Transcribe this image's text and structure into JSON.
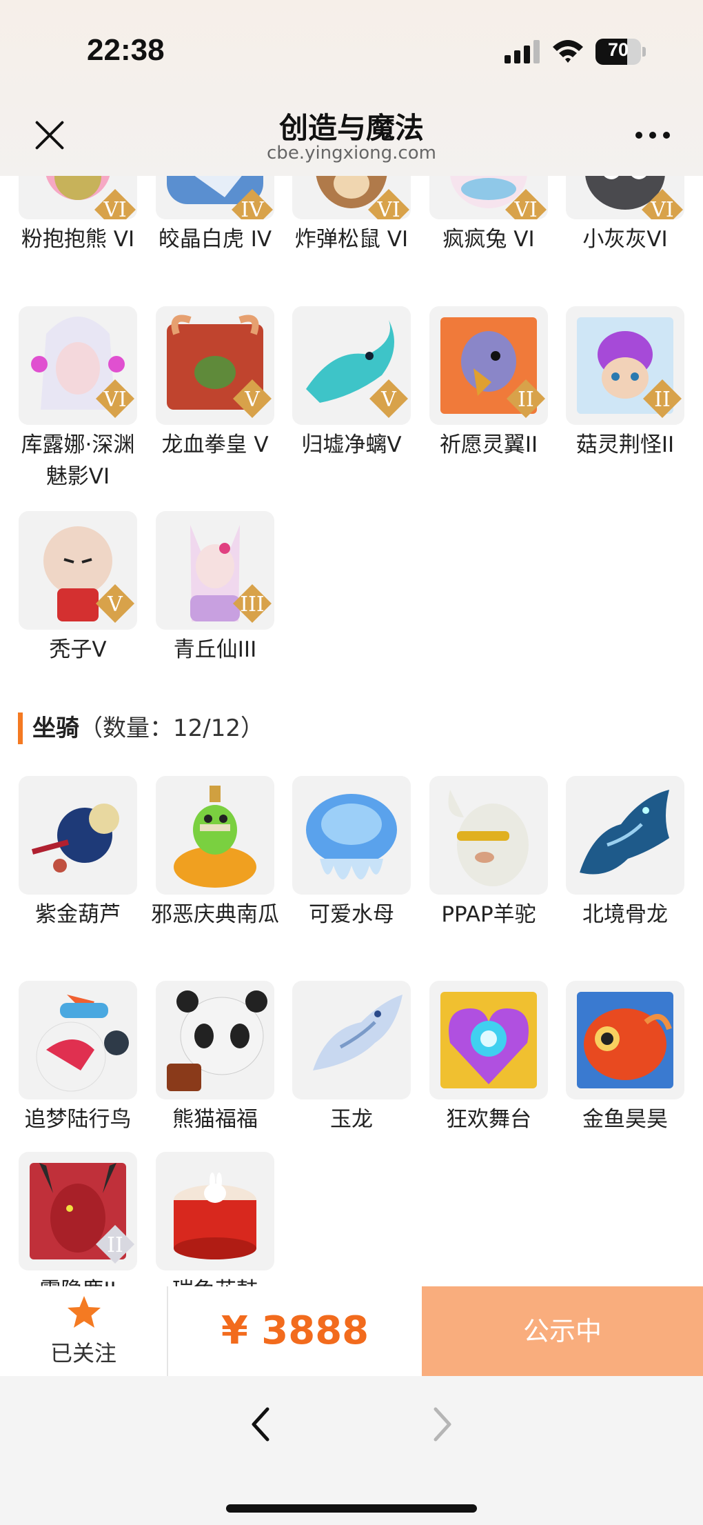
{
  "status_bar": {
    "time": "22:38",
    "battery": "70"
  },
  "header": {
    "title": "创造与魔法",
    "url": "cbe.yingxiong.com"
  },
  "pets": [
    {
      "name": "粉抱抱熊 VI",
      "tier": "VI"
    },
    {
      "name": "皎晶白虎 IV",
      "tier": "IV"
    },
    {
      "name": "炸弹松鼠 VI",
      "tier": "VI"
    },
    {
      "name": "疯疯兔 VI",
      "tier": "VI"
    },
    {
      "name": "小灰灰VI",
      "tier": "VI"
    },
    {
      "name": "库露娜·深渊魅影VI",
      "tier": "VI"
    },
    {
      "name": "龙血拳皇 V",
      "tier": "V"
    },
    {
      "name": "归墟净螭V",
      "tier": "V"
    },
    {
      "name": "祈愿灵翼II",
      "tier": "II"
    },
    {
      "name": "菇灵荆怪II",
      "tier": "II"
    },
    {
      "name": "秃子V",
      "tier": "V"
    },
    {
      "name": "青丘仙III",
      "tier": "III"
    }
  ],
  "mounts_section": {
    "title": "坐骑",
    "count": "（数量：12/12）"
  },
  "mounts": [
    {
      "name": "紫金葫芦",
      "tier": ""
    },
    {
      "name": "邪恶庆典南瓜",
      "tier": ""
    },
    {
      "name": "可爱水母",
      "tier": ""
    },
    {
      "name": "PPAP羊驼",
      "tier": ""
    },
    {
      "name": "北境骨龙",
      "tier": ""
    },
    {
      "name": "追梦陆行鸟",
      "tier": ""
    },
    {
      "name": "熊猫福福",
      "tier": ""
    },
    {
      "name": "玉龙",
      "tier": ""
    },
    {
      "name": "狂欢舞台",
      "tier": ""
    },
    {
      "name": "金鱼昊昊",
      "tier": ""
    },
    {
      "name": "霞隐鹿II",
      "tier": "II"
    },
    {
      "name": "瑞兔花鼓",
      "tier": ""
    }
  ],
  "action_bar": {
    "follow_label": "已关注",
    "price": "¥ 3888",
    "status_label": "公示中"
  },
  "colors": {
    "accent": "#f47a22",
    "price": "#f26b1d",
    "status_button": "#f9ad7d"
  }
}
